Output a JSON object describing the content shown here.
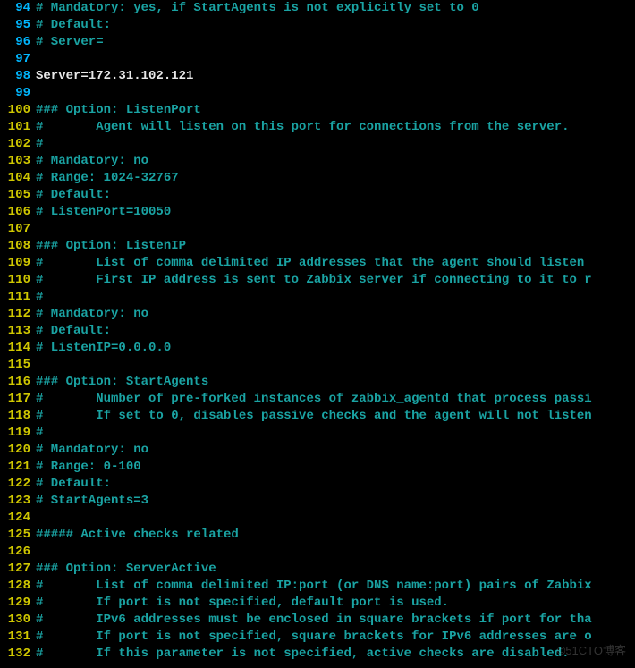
{
  "watermark": "©51CTO博客",
  "lines": [
    {
      "n": "94",
      "hl": true,
      "cls": "comment",
      "t": "# Mandatory: yes, if StartAgents is not explicitly set to 0"
    },
    {
      "n": "95",
      "hl": true,
      "cls": "comment",
      "t": "# Default:"
    },
    {
      "n": "96",
      "hl": true,
      "cls": "comment",
      "t": "# Server="
    },
    {
      "n": "97",
      "hl": true,
      "cls": "comment",
      "t": ""
    },
    {
      "n": "98",
      "hl": true,
      "cls": "code",
      "t": "Server=172.31.102.121"
    },
    {
      "n": "99",
      "hl": true,
      "cls": "comment",
      "t": ""
    },
    {
      "n": "100",
      "hl": false,
      "cls": "comment",
      "t": "### Option: ListenPort"
    },
    {
      "n": "101",
      "hl": false,
      "cls": "comment",
      "t": "#       Agent will listen on this port for connections from the server."
    },
    {
      "n": "102",
      "hl": false,
      "cls": "comment",
      "t": "#"
    },
    {
      "n": "103",
      "hl": false,
      "cls": "comment",
      "t": "# Mandatory: no"
    },
    {
      "n": "104",
      "hl": false,
      "cls": "comment",
      "t": "# Range: 1024-32767"
    },
    {
      "n": "105",
      "hl": false,
      "cls": "comment",
      "t": "# Default:"
    },
    {
      "n": "106",
      "hl": false,
      "cls": "comment",
      "t": "# ListenPort=10050"
    },
    {
      "n": "107",
      "hl": false,
      "cls": "comment",
      "t": ""
    },
    {
      "n": "108",
      "hl": false,
      "cls": "comment",
      "t": "### Option: ListenIP"
    },
    {
      "n": "109",
      "hl": false,
      "cls": "comment",
      "t": "#       List of comma delimited IP addresses that the agent should listen "
    },
    {
      "n": "110",
      "hl": false,
      "cls": "comment",
      "t": "#       First IP address is sent to Zabbix server if connecting to it to r"
    },
    {
      "n": "111",
      "hl": false,
      "cls": "comment",
      "t": "#"
    },
    {
      "n": "112",
      "hl": false,
      "cls": "comment",
      "t": "# Mandatory: no"
    },
    {
      "n": "113",
      "hl": false,
      "cls": "comment",
      "t": "# Default:"
    },
    {
      "n": "114",
      "hl": false,
      "cls": "comment",
      "t": "# ListenIP=0.0.0.0"
    },
    {
      "n": "115",
      "hl": false,
      "cls": "comment",
      "t": ""
    },
    {
      "n": "116",
      "hl": false,
      "cls": "comment",
      "t": "### Option: StartAgents"
    },
    {
      "n": "117",
      "hl": false,
      "cls": "comment",
      "t": "#       Number of pre-forked instances of zabbix_agentd that process passi"
    },
    {
      "n": "118",
      "hl": false,
      "cls": "comment",
      "t": "#       If set to 0, disables passive checks and the agent will not listen"
    },
    {
      "n": "119",
      "hl": false,
      "cls": "comment",
      "t": "#"
    },
    {
      "n": "120",
      "hl": false,
      "cls": "comment",
      "t": "# Mandatory: no"
    },
    {
      "n": "121",
      "hl": false,
      "cls": "comment",
      "t": "# Range: 0-100"
    },
    {
      "n": "122",
      "hl": false,
      "cls": "comment",
      "t": "# Default:"
    },
    {
      "n": "123",
      "hl": false,
      "cls": "comment",
      "t": "# StartAgents=3"
    },
    {
      "n": "124",
      "hl": false,
      "cls": "comment",
      "t": ""
    },
    {
      "n": "125",
      "hl": false,
      "cls": "comment",
      "t": "##### Active checks related"
    },
    {
      "n": "126",
      "hl": false,
      "cls": "comment",
      "t": ""
    },
    {
      "n": "127",
      "hl": false,
      "cls": "comment",
      "t": "### Option: ServerActive"
    },
    {
      "n": "128",
      "hl": false,
      "cls": "comment",
      "t": "#       List of comma delimited IP:port (or DNS name:port) pairs of Zabbix"
    },
    {
      "n": "129",
      "hl": false,
      "cls": "comment",
      "t": "#       If port is not specified, default port is used."
    },
    {
      "n": "130",
      "hl": false,
      "cls": "comment",
      "t": "#       IPv6 addresses must be enclosed in square brackets if port for tha"
    },
    {
      "n": "131",
      "hl": false,
      "cls": "comment",
      "t": "#       If port is not specified, square brackets for IPv6 addresses are o"
    },
    {
      "n": "132",
      "hl": false,
      "cls": "comment",
      "t": "#       If this parameter is not specified, active checks are disabled."
    }
  ]
}
